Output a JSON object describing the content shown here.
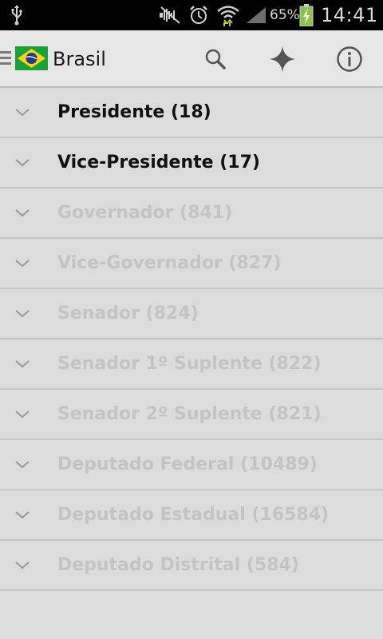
{
  "status_bar": {
    "battery_percent": "65%",
    "time": "14:41",
    "icons": [
      "usb-icon",
      "mute-icon",
      "alarm-icon",
      "wifi-icon",
      "signal-icon",
      "battery-charging-icon"
    ]
  },
  "action_bar": {
    "title": "Brasil",
    "flag": "brazil-flag",
    "actions": [
      "search-icon",
      "sparkle-icon",
      "info-icon"
    ]
  },
  "positions": [
    {
      "label": "Presidente (18)",
      "enabled": true
    },
    {
      "label": "Vice-Presidente (17)",
      "enabled": true
    },
    {
      "label": "Governador (841)",
      "enabled": false
    },
    {
      "label": "Vice-Governador (827)",
      "enabled": false
    },
    {
      "label": "Senador (824)",
      "enabled": false
    },
    {
      "label": "Senador 1º Suplente (822)",
      "enabled": false
    },
    {
      "label": "Senador 2º Suplente (821)",
      "enabled": false
    },
    {
      "label": "Deputado Federal (10489)",
      "enabled": false
    },
    {
      "label": "Deputado Estadual (16584)",
      "enabled": false
    },
    {
      "label": "Deputado Distrital (584)",
      "enabled": false
    }
  ],
  "colors": {
    "background": "#dcdcdc",
    "active_text": "#111111",
    "inactive_text": "#c4c4c4",
    "divider": "#c6c6c6",
    "status_bar": "#000000"
  }
}
